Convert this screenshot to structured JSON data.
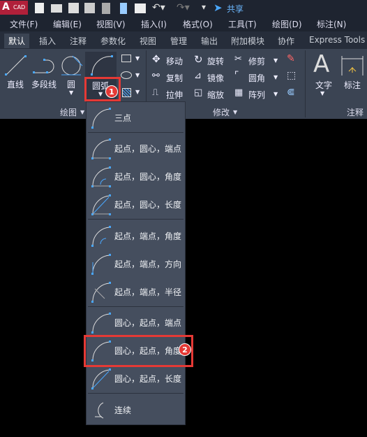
{
  "app": {
    "logo_letter": "A",
    "logo_text": "CAD",
    "share_label": "共享"
  },
  "menu": [
    "文件(F)",
    "编辑(E)",
    "视图(V)",
    "插入(I)",
    "格式(O)",
    "工具(T)",
    "绘图(D)",
    "标注(N)"
  ],
  "tabs": [
    "默认",
    "插入",
    "注释",
    "参数化",
    "视图",
    "管理",
    "输出",
    "附加模块",
    "协作",
    "Express Tools"
  ],
  "active_tab": "默认",
  "ribbon": {
    "draw": {
      "line": "直线",
      "polyline": "多段线",
      "circle": "圆",
      "arc": "圆弧",
      "panel_label": "绘图"
    },
    "modify": {
      "move": "移动",
      "rotate": "旋转",
      "trim": "修剪",
      "copy": "复制",
      "mirror": "镜像",
      "fillet": "圆角",
      "stretch": "拉伸",
      "scale": "缩放",
      "array": "阵列",
      "panel_label": "修改"
    },
    "annotation": {
      "text": "文字",
      "dimension": "标注",
      "panel_label": "注释"
    }
  },
  "arc_menu": {
    "items": [
      "三点",
      "起点，圆心，端点",
      "起点，圆心，角度",
      "起点，圆心，长度",
      "起点，端点，角度",
      "起点，端点，方向",
      "起点，端点，半径",
      "圆心，起点，端点",
      "圆心，起点，角度",
      "圆心，起点，长度",
      "连续"
    ],
    "highlighted": "圆心，起点，角度"
  },
  "badges": [
    "1",
    "2"
  ],
  "colors": {
    "highlight": "#e53935",
    "accent": "#4aa8ff"
  }
}
